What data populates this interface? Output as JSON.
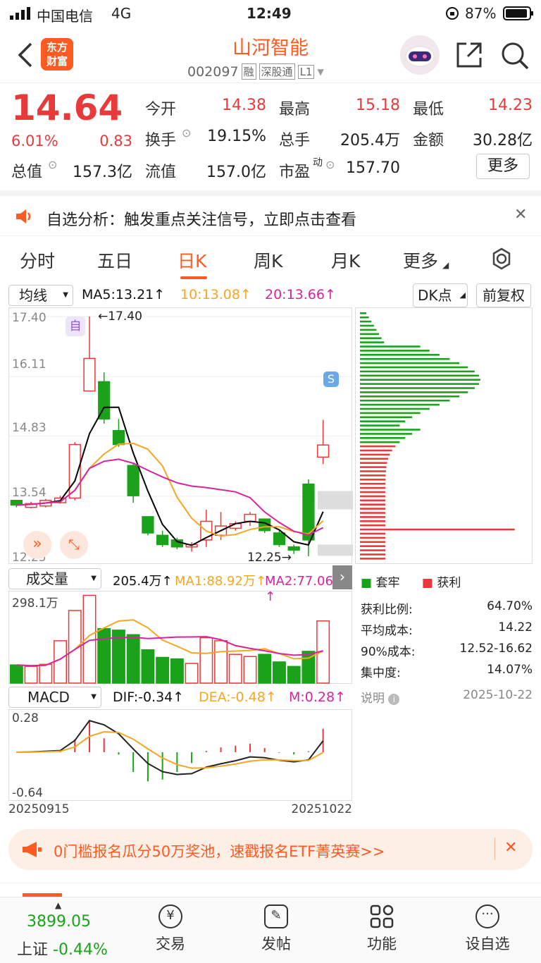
{
  "status": {
    "carrier": "中国电信",
    "network": "4G",
    "time": "12:49",
    "battery": "87%"
  },
  "header": {
    "title": "山河智能",
    "code": "002097",
    "tag_rong": "融",
    "tag_sgt": "深股通",
    "tag_level": "L1",
    "logo_line1": "东方",
    "logo_line2": "财富"
  },
  "quote": {
    "price": "14.64",
    "change_pct": "6.01%",
    "change": "0.83",
    "open_label": "今开",
    "open": "14.38",
    "high_label": "最高",
    "high": "15.18",
    "low_label": "最低",
    "low": "14.23",
    "turnover_label": "换手",
    "turnover": "19.15%",
    "volume_label": "总手",
    "volume": "205.4万",
    "amount_label": "金额",
    "amount": "30.28亿",
    "mcap_label": "总值",
    "mcap": "157.3亿",
    "float_label": "流值",
    "float": "157.0亿",
    "pe_label": "市盈",
    "pe_sup": "动",
    "pe": "157.70",
    "more": "更多"
  },
  "notice": {
    "text": "自选分析：触发重点关注信号，立即点击查看"
  },
  "tabs": [
    "分时",
    "五日",
    "日K",
    "周K",
    "月K",
    "更多"
  ],
  "kline": {
    "ma_select": "均线",
    "ma5": "MA5:13.21↑",
    "ma10": "10:13.08↑",
    "ma20": "20:13.66↑",
    "dk": "DK点",
    "fq": "前复权",
    "ylabels": [
      "17.40",
      "16.11",
      "14.83",
      "13.54",
      "12.25"
    ],
    "high_mark": "←17.40",
    "low_mark": "12.25→",
    "self_mark": "自",
    "s_mark": "S"
  },
  "volume": {
    "select": "成交量",
    "value": "205.4万↑",
    "ma1": "MA1:88.92万↑",
    "ma2": "MA2:77.06万↑",
    "ymax": "298.1万"
  },
  "macd": {
    "select": "MACD",
    "dif": "DIF:-0.34↑",
    "dea": "DEA:-0.48↑",
    "m": "M:0.28↑",
    "ytop": "0.28",
    "ybot": "-0.64",
    "date_start": "20250915",
    "date_end": "20251022"
  },
  "chips": {
    "legend_trap": "套牢",
    "legend_profit": "获利",
    "rows": [
      {
        "label": "获利比例:",
        "value": "64.70%"
      },
      {
        "label": "平均成本:",
        "value": "14.22"
      },
      {
        "label": "90%成本:",
        "value": "12.52-16.62"
      },
      {
        "label": "集中度:",
        "value": "14.07%"
      }
    ],
    "note": "说明",
    "date": "2025-10-22"
  },
  "promo": {
    "text": "0门槛报名瓜分50万奖池，速戳报名ETF菁英赛>>"
  },
  "bottom_nav": {
    "index_value": "3899.05",
    "index_name": "上证",
    "index_change": "-0.44%",
    "items": [
      "交易",
      "发帖",
      "功能",
      "设自选"
    ]
  },
  "colors": {
    "up": "#e83a3a",
    "down": "#1aa31a",
    "ma5": "#000000",
    "ma10": "#f5a623",
    "ma20": "#d6249f",
    "accent": "#ff5a1f"
  },
  "chart_data": {
    "type": "candlestick",
    "ylim": [
      12.25,
      17.4
    ],
    "candles": [
      {
        "o": 13.45,
        "c": 13.35,
        "h": 13.45,
        "l": 13.3
      },
      {
        "o": 13.3,
        "c": 13.38,
        "h": 13.42,
        "l": 13.28
      },
      {
        "o": 13.33,
        "c": 13.45,
        "h": 13.48,
        "l": 13.3
      },
      {
        "o": 13.4,
        "c": 13.5,
        "h": 13.55,
        "l": 13.38
      },
      {
        "o": 13.5,
        "c": 14.65,
        "h": 14.7,
        "l": 13.45
      },
      {
        "o": 15.8,
        "c": 16.5,
        "h": 17.4,
        "l": 15.8
      },
      {
        "o": 16.0,
        "c": 15.2,
        "h": 16.2,
        "l": 15.1
      },
      {
        "o": 14.95,
        "c": 14.65,
        "h": 15.2,
        "l": 14.6
      },
      {
        "o": 14.2,
        "c": 13.55,
        "h": 14.25,
        "l": 13.4
      },
      {
        "o": 13.1,
        "c": 12.75,
        "h": 13.1,
        "l": 12.7
      },
      {
        "o": 12.7,
        "c": 12.5,
        "h": 12.8,
        "l": 12.45
      },
      {
        "o": 12.6,
        "c": 12.45,
        "h": 12.65,
        "l": 12.4
      },
      {
        "o": 12.45,
        "c": 12.5,
        "h": 12.55,
        "l": 12.35
      },
      {
        "o": 12.6,
        "c": 13.0,
        "h": 13.25,
        "l": 12.45
      },
      {
        "o": 12.7,
        "c": 12.9,
        "h": 13.2,
        "l": 12.6
      },
      {
        "o": 12.85,
        "c": 12.95,
        "h": 13.0,
        "l": 12.8
      },
      {
        "o": 13.0,
        "c": 13.15,
        "h": 13.2,
        "l": 12.9
      },
      {
        "o": 13.05,
        "c": 12.8,
        "h": 13.05,
        "l": 12.75
      },
      {
        "o": 12.75,
        "c": 12.5,
        "h": 12.8,
        "l": 12.45
      },
      {
        "o": 12.45,
        "c": 12.38,
        "h": 12.5,
        "l": 12.3
      },
      {
        "o": 13.8,
        "c": 12.6,
        "h": 13.9,
        "l": 12.25
      },
      {
        "o": 14.38,
        "c": 14.64,
        "h": 15.18,
        "l": 14.23
      }
    ],
    "volumes": [
      60,
      55,
      62,
      140,
      240,
      290,
      180,
      175,
      160,
      110,
      85,
      80,
      65,
      150,
      140,
      95,
      88,
      95,
      70,
      55,
      105,
      205.4
    ],
    "volume_ylim": [
      0,
      298.1
    ]
  }
}
